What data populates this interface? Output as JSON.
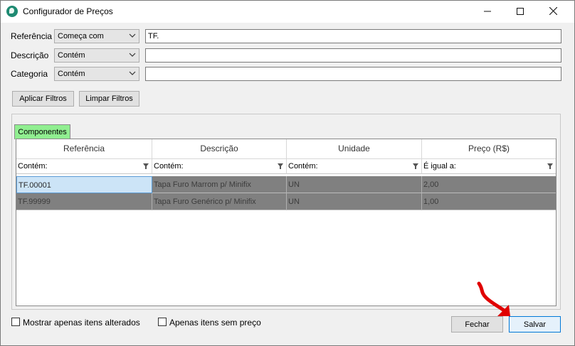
{
  "window": {
    "title": "Configurador de Preços"
  },
  "filters": [
    {
      "label": "Referência",
      "mode": "Começa com",
      "value": "TF."
    },
    {
      "label": "Descrição",
      "mode": "Contém",
      "value": ""
    },
    {
      "label": "Categoria",
      "mode": "Contém",
      "value": ""
    }
  ],
  "buttons": {
    "apply": "Aplicar Filtros",
    "clear": "Limpar Filtros",
    "close": "Fechar",
    "save": "Salvar"
  },
  "tab": {
    "label": "Componentes",
    "color": "#90ee90"
  },
  "grid": {
    "columns": [
      "Referência",
      "Descrição",
      "Unidade",
      "Preço (R$)"
    ],
    "filter_row": [
      "Contém:",
      "Contém:",
      "Contém:",
      "É igual a:"
    ],
    "rows": [
      [
        "TF.00001",
        "Tapa Furo Marrom p/ Minifix",
        "UN",
        "2,00"
      ],
      [
        "TF.99999",
        "Tapa Furo Genérico p/ Minifix",
        "UN",
        "1,00"
      ]
    ]
  },
  "checkboxes": [
    {
      "label": "Mostrar apenas itens alterados",
      "checked": false
    },
    {
      "label": "Apenas itens sem preço",
      "checked": false
    }
  ],
  "icons": {
    "minimize": "minimize-icon",
    "maximize": "maximize-icon",
    "close": "close-icon",
    "annotation": "red-arrow-icon"
  },
  "colors": {
    "annotation_arrow": "#e00000",
    "selected_cell": "#cce4f7",
    "row_bg": "#808080"
  }
}
